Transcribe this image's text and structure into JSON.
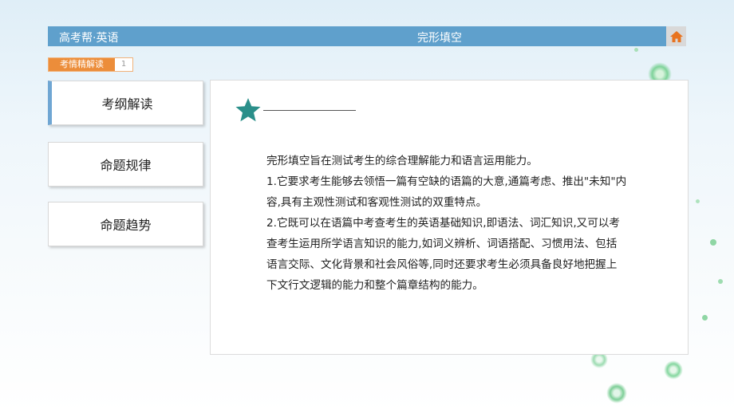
{
  "header": {
    "brand": "高考帮·英语",
    "chapter_title": "完形填空",
    "home_icon": "home-icon"
  },
  "section": {
    "label": "考情精解读",
    "number": "1"
  },
  "nav": {
    "items": [
      {
        "label": "考纲解读",
        "active": true
      },
      {
        "label": "命题规律",
        "active": false
      },
      {
        "label": "命题趋势",
        "active": false
      }
    ]
  },
  "content": {
    "icon": "star-icon",
    "paragraphs": [
      "完形填空旨在测试考生的综合理解能力和语言运用能力。",
      "1.它要求考生能够去领悟一篇有空缺的语篇的大意,通篇考虑、推出\"未知\"内容,具有主观性测试和客观性测试的双重特点。",
      "2.它既可以在语篇中考查考生的英语基础知识,即语法、词汇知识,又可以考查考生运用所学语言知识的能力,如词义辨析、词语搭配、习惯用法、包括语言交际、文化背景和社会风俗等,同时还要求考生必须具备良好地把握上下文行文逻辑的能力和整个篇章结构的能力。"
    ]
  },
  "colors": {
    "header_bg": "#5fa0cc",
    "accent_orange": "#ec8d3a",
    "star_teal": "#2a8f8a",
    "active_nav_border": "#6fa6d3"
  }
}
